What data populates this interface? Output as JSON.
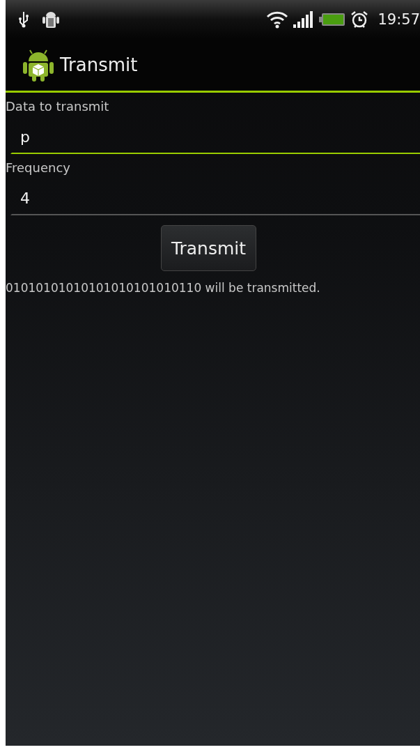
{
  "status_bar": {
    "time": "19:57"
  },
  "action_bar": {
    "title": "Transmit"
  },
  "fields": [
    {
      "label": "Data to transmit",
      "value": "p",
      "focused": true
    },
    {
      "label": "Frequency",
      "value": "4",
      "focused": false
    }
  ],
  "button": {
    "label": "Transmit"
  },
  "result": "01010101010101010101010110 will be transmitted."
}
